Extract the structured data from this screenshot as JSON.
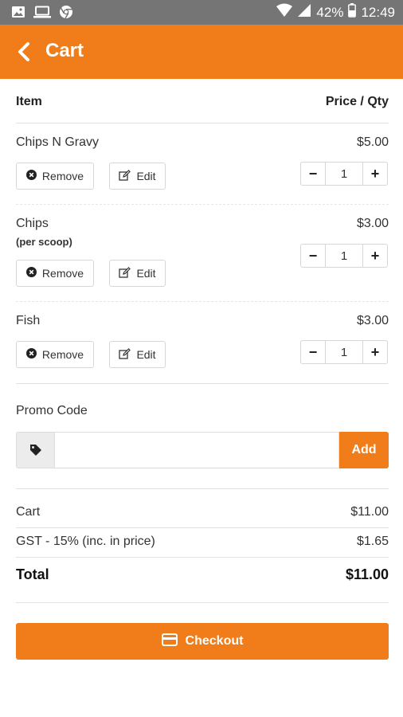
{
  "status_bar": {
    "battery": "42%",
    "time": "12:49",
    "icons": [
      "image-icon",
      "laptop-icon",
      "chrome-icon",
      "wifi-icon",
      "signal-icon",
      "battery-icon"
    ]
  },
  "app_bar": {
    "title": "Cart",
    "back_icon": "chevron-left-icon",
    "color": "#f07d1a"
  },
  "table_header": {
    "item": "Item",
    "price_qty": "Price / Qty"
  },
  "cart_items": [
    {
      "name": "Chips N Gravy",
      "note": "",
      "price": "$5.00",
      "qty": "1",
      "remove_label": "Remove",
      "edit_label": "Edit"
    },
    {
      "name": "Chips",
      "note": "(per scoop)",
      "price": "$3.00",
      "qty": "1",
      "remove_label": "Remove",
      "edit_label": "Edit"
    },
    {
      "name": "Fish",
      "note": "",
      "price": "$3.00",
      "qty": "1",
      "remove_label": "Remove",
      "edit_label": "Edit"
    }
  ],
  "qty_controls": {
    "minus": "−",
    "plus": "+"
  },
  "promo": {
    "label": "Promo Code",
    "value": "",
    "placeholder": "",
    "add_label": "Add",
    "icon": "tag-icon"
  },
  "summary": {
    "cart_label": "Cart",
    "cart_value": "$11.00",
    "gst_label": "GST - 15% (inc. in price)",
    "gst_value": "$1.65",
    "total_label": "Total",
    "total_value": "$11.00"
  },
  "checkout": {
    "label": "Checkout",
    "icon": "credit-card-icon"
  }
}
